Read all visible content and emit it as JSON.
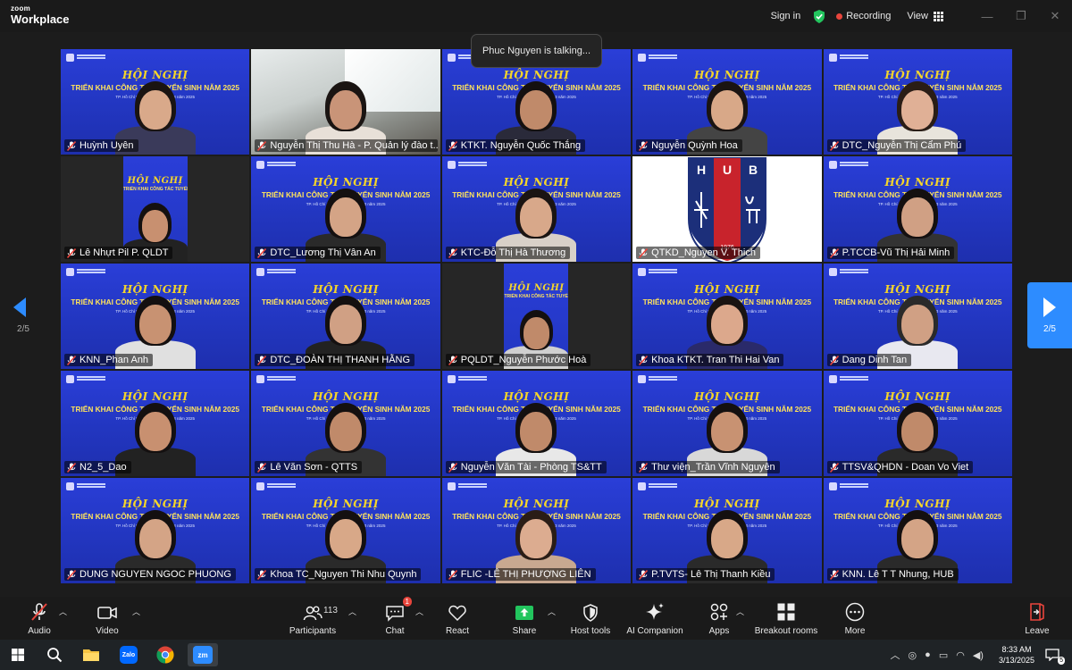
{
  "app": {
    "logo_line1": "zoom",
    "logo_line2": "Workplace"
  },
  "topbar": {
    "signin": "Sign in",
    "recording": "Recording",
    "view": "View",
    "minimize": "—",
    "maximize": "❐",
    "close": "✕"
  },
  "talking": "Phuc Nguyen is talking...",
  "pager": {
    "left": "2/5",
    "right": "2/5"
  },
  "banner": {
    "title": "HỘI NGHỊ",
    "subtitle": "TRIỂN KHAI CÔNG TÁC TUYỂN SINH NĂM 2025",
    "date": "TP. Hồ Chí Minh, ngày 13 tháng 3 năm 2025"
  },
  "hub_logo": {
    "letters": "HUB",
    "year": "1976"
  },
  "participants": [
    {
      "name": "Huỳnh Uyên",
      "bg": "conf",
      "skin": "#d9a98a",
      "hair": "#1a1412",
      "shirt": "#3a3a5a"
    },
    {
      "name": "Nguyễn Thị Thu Hà - P. Quản lý đào t...",
      "bg": "office",
      "skin": "#c99478",
      "hair": "#1a1412",
      "shirt": "#e8e0d8"
    },
    {
      "name": "KTKT. Nguyễn Quốc Thắng",
      "bg": "conf",
      "skin": "#c08a6a",
      "hair": "#141010",
      "shirt": "#2a2a3a"
    },
    {
      "name": "Nguyễn Quỳnh Hoa",
      "bg": "conf",
      "skin": "#d8a888",
      "hair": "#1a1412",
      "shirt": "#444"
    },
    {
      "name": "DTC_Nguyễn Thị Cẩm Phú",
      "bg": "conf",
      "skin": "#e0b096",
      "hair": "#2a1d16",
      "shirt": "#e8e4dc"
    },
    {
      "name": "Lê Nhựt Pil P. QLDT",
      "bg": "narrow",
      "skin": "#c89070",
      "hair": "#141010",
      "shirt": "#222"
    },
    {
      "name": "DTC_Lương Thị Vân An",
      "bg": "conf",
      "skin": "#d4a486",
      "hair": "#141010",
      "shirt": "#2a2a2a"
    },
    {
      "name": "KTC-Đỗ Thị Hà Thương",
      "bg": "conf",
      "skin": "#d8a88a",
      "hair": "#1a1412",
      "shirt": "#d8d0c8"
    },
    {
      "name": "QTKD_Nguyen V. Thich",
      "bg": "logo",
      "skin": "",
      "hair": "",
      "shirt": ""
    },
    {
      "name": "P.TCCB-Vũ Thị Hải Minh",
      "bg": "conf",
      "skin": "#d0a084",
      "hair": "#141010",
      "shirt": "#333"
    },
    {
      "name": "KNN_Phan Anh",
      "bg": "conf",
      "skin": "#c89272",
      "hair": "#141010",
      "shirt": "#e0e0e0"
    },
    {
      "name": "DTC_ĐOÀN THỊ THANH HẰNG",
      "bg": "conf",
      "skin": "#d0a084",
      "hair": "#141010",
      "shirt": "#222"
    },
    {
      "name": "PQLDT_Nguyễn Phước Hoà",
      "bg": "narrow",
      "skin": "#c08a6a",
      "hair": "#141010",
      "shirt": "#d0d0d0"
    },
    {
      "name": "Khoa KTKT. Tran Thi Hai Van",
      "bg": "conf",
      "skin": "#dca88c",
      "hair": "#1a1412",
      "shirt": "#2a2a6a"
    },
    {
      "name": "Dang Dinh Tan",
      "bg": "conf",
      "skin": "#d0a084",
      "hair": "#2a2a2a",
      "shirt": "#e8e8f0"
    },
    {
      "name": "N2_5_Dao",
      "bg": "conf",
      "skin": "#c89070",
      "hair": "#141010",
      "shirt": "#222"
    },
    {
      "name": "Lê Văn Sơn - QTTS",
      "bg": "conf",
      "skin": "#c08a6a",
      "hair": "#141010",
      "shirt": "#333"
    },
    {
      "name": "Nguyễn Văn Tài - Phòng TS&TT",
      "bg": "conf",
      "skin": "#c08a6a",
      "hair": "#141010",
      "shirt": "#e8e8e8"
    },
    {
      "name": "Thư viện_Trần Vĩnh Nguyên",
      "bg": "conf",
      "skin": "#c89272",
      "hair": "#141010",
      "shirt": "#d8d8d8"
    },
    {
      "name": "TTSV&QHDN - Doan Vo Viet",
      "bg": "conf",
      "skin": "#c08a6a",
      "hair": "#141010",
      "shirt": "#2a2a2a"
    },
    {
      "name": "DUNG NGUYEN NGOC PHUONG",
      "bg": "conf",
      "skin": "#d4a486",
      "hair": "#141010",
      "shirt": "#2a2a2a"
    },
    {
      "name": "Khoa TC_Nguyen Thi Nhu Quynh",
      "bg": "conf",
      "skin": "#d8a888",
      "hair": "#141010",
      "shirt": "#2a2a2a"
    },
    {
      "name": "FLIC -LÊ THỊ PHƯỢNG LIÊN",
      "bg": "conf",
      "skin": "#dcac90",
      "hair": "#2a1d16",
      "shirt": "#c8a890"
    },
    {
      "name": "P.TVTS- Lê Thị Thanh Kiều",
      "bg": "conf",
      "skin": "#d8a888",
      "hair": "#141010",
      "shirt": "#2a2a2a"
    },
    {
      "name": "KNN. Lê T T Nhung, HUB",
      "bg": "conf",
      "skin": "#d4a486",
      "hair": "#141010",
      "shirt": "#2a2a2a"
    }
  ],
  "toolbar": {
    "audio": "Audio",
    "video": "Video",
    "participants": "Participants",
    "participants_count": "113",
    "chat": "Chat",
    "chat_badge": "1",
    "react": "React",
    "share": "Share",
    "host_tools": "Host tools",
    "ai_companion": "AI Companion",
    "apps": "Apps",
    "breakout_rooms": "Breakout rooms",
    "more": "More",
    "leave": "Leave"
  },
  "taskbar": {
    "zalo": "Zalo",
    "zoom": "zm",
    "time": "8:33 AM",
    "date": "3/13/2025",
    "notif_count": "5"
  },
  "colors": {
    "accent": "#2d8cff",
    "record": "#e8453c",
    "shield": "#23c55e",
    "share": "#22c55e",
    "banner_blue": "#2638c8",
    "banner_yellow": "#f5d52a"
  }
}
